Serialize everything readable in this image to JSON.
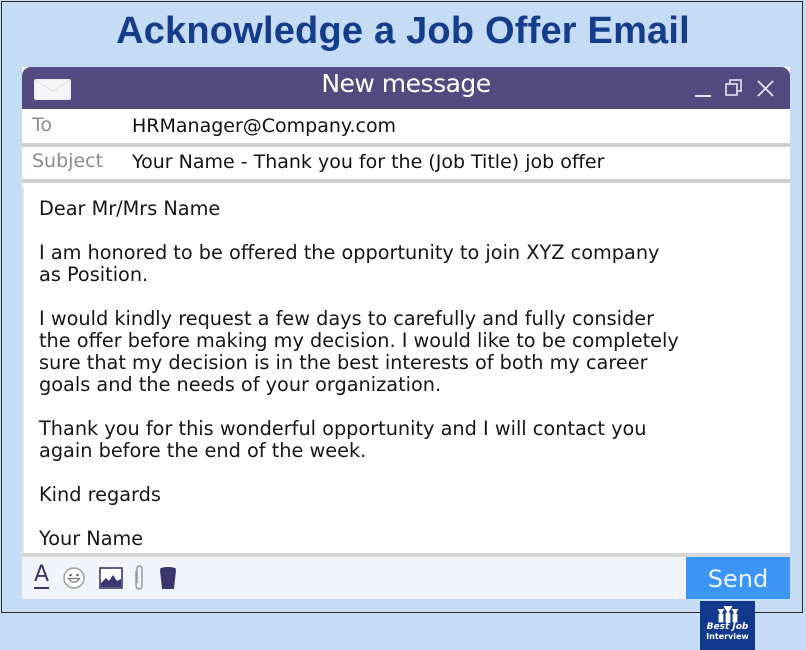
{
  "headline": "Acknowledge a Job Offer Email",
  "window": {
    "title": "New message",
    "controls": {
      "minimize_icon": "minimize-icon",
      "maximize_icon": "restore-icon",
      "close_icon": "close-icon"
    },
    "app_icon": "envelope-icon"
  },
  "fields": {
    "to": {
      "label": "To",
      "value": "HRManager@Company.com"
    },
    "subject": {
      "label": "Subject",
      "value": "Your Name - Thank you for the (Job Title) job offer"
    }
  },
  "body": {
    "paragraphs": [
      "Dear Mr/Mrs Name",
      "I am honored to be offered the opportunity to join XYZ company\nas Position.",
      "I would kindly request a few days to carefully and fully consider\nthe offer before making my decision. I would like to be completely\nsure that my decision is in the best interests of both my career\ngoals and the needs of your organization.",
      "Thank you for this wonderful opportunity and I will contact you\nagain before the end of the week.",
      "Kind regards",
      "Your Name"
    ]
  },
  "logo": {
    "line1": "Best Job",
    "line2": "Interview"
  },
  "toolbar": {
    "font_label": "A",
    "icons": [
      "font-format-icon",
      "emoji-icon",
      "image-icon",
      "attachment-icon",
      "trash-icon"
    ]
  },
  "send_label": "Send",
  "colors": {
    "background": "#c6dcf4",
    "headline": "#163d8c",
    "titlebar": "#534a7f",
    "send": "#3b95f5",
    "toolbar_icons": "#3b3570",
    "logo_bg": "#113a8e"
  }
}
